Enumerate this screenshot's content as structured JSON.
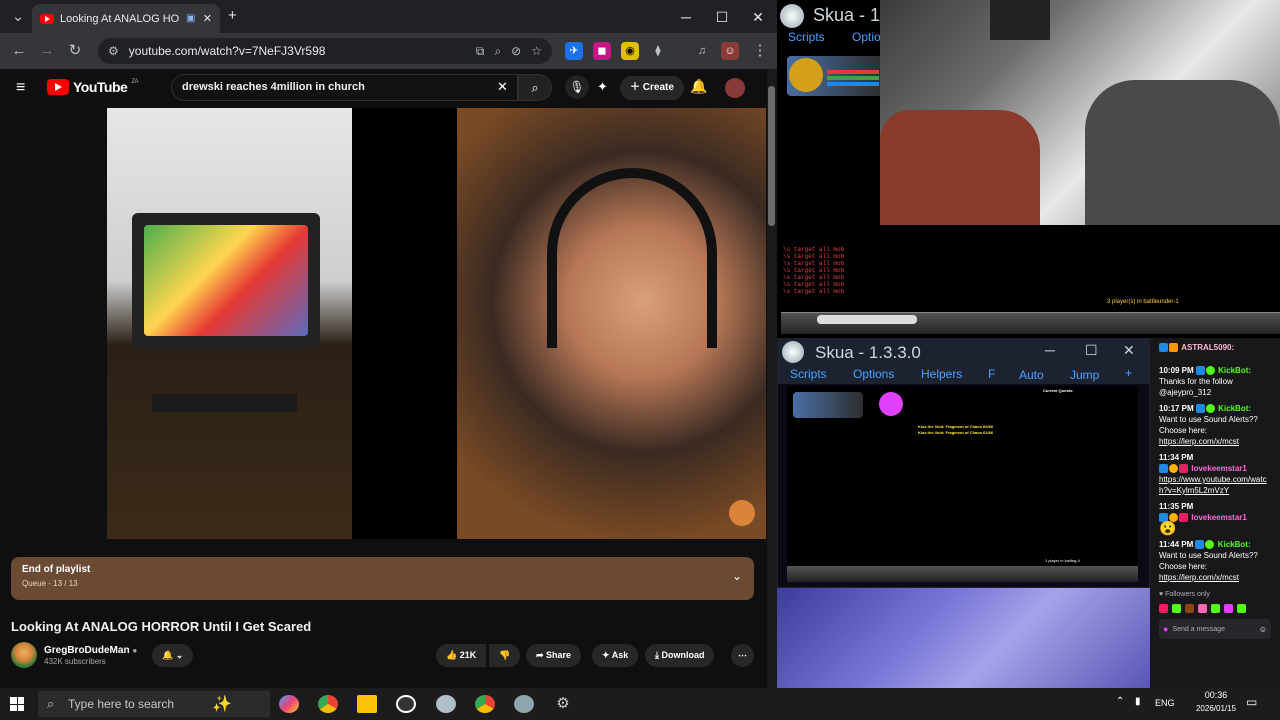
{
  "browser": {
    "tab_title": "Looking At ANALOG HORRO",
    "new_tab": "+",
    "url": "youtube.com/watch?v=7NeFJ3Vr598",
    "controls": {
      "minimize": "─",
      "maximize": "☐",
      "close": "✕"
    },
    "nav": {
      "back": "←",
      "forward": "→",
      "reload": "↻",
      "menu": "⋮"
    }
  },
  "youtube": {
    "logo_text": "YouTube",
    "region": "ZA",
    "search_query": "drewski reaches 4million in church",
    "create_label": "Create",
    "playlist": {
      "title": "End of playlist",
      "queue": "Queue - 13 / 13"
    },
    "video_title": "Looking At ANALOG HORROR Until I Get Scared",
    "channel": {
      "name": "GregBroDudeMan",
      "subscribers": "432K subscribers"
    },
    "actions": {
      "likes": "21K",
      "share": "Share",
      "ask": "Ask",
      "download": "Download"
    }
  },
  "skua_top": {
    "title": "Skua - 1",
    "menu": [
      "Scripts",
      "Optio"
    ],
    "log_lines": [
      "\\s target all mob",
      "\\s target all mob",
      "\\s target all mob",
      "\\s target all mob",
      "\\s target all mob",
      "\\s target all mob",
      "\\s target all mob"
    ],
    "status": "3 player(s) in battleunder-1"
  },
  "skua_bottom": {
    "title": "Skua - 1.3.3.0",
    "menu": [
      "Scripts",
      "Options",
      "Helpers",
      "F",
      "Auto",
      "Jump",
      "+"
    ],
    "quest_header": "Current Quests:",
    "kill_text_1": "Kiss the Void: Fragment of Chaos 60/66",
    "kill_text_2": "Kiss the Void: Fragment of Chaos 61/66",
    "player_count": "1 player in lostfeg-4"
  },
  "chat": {
    "top_user": "ASTRAL5090:",
    "messages": [
      {
        "time": "10:09 PM",
        "user": "KickBot:",
        "text": "Thanks for the follow @ajeypro_312",
        "link": ""
      },
      {
        "time": "10:17 PM",
        "user": "KickBot:",
        "text": "Want to use Sound Alerts?? Choose here:",
        "link": "https://lerp.com/x/mcst"
      },
      {
        "time": "11:34 PM",
        "user": "lovekeemstar1",
        "text": "",
        "link": "https://www.youtube.com/watch?v=Kylm5L2mVzY"
      },
      {
        "time": "11:35 PM",
        "user": "lovekeemstar1",
        "text": "",
        "link": ""
      },
      {
        "time": "11:44 PM",
        "user": "KickBot:",
        "text": "Want to use Sound Alerts?? Choose here:",
        "link": "https://lerp.com/x/mcst"
      }
    ],
    "followers_only": "Followers only",
    "send_placeholder": "Send a message"
  },
  "taskbar": {
    "search_placeholder": "Type here to search",
    "language": "ENG",
    "time": "00:36",
    "date": "2026/01/15"
  },
  "colors": {
    "youtube_red": "#ff0000",
    "kick_green": "#53fc18",
    "playlist_bg": "#6b4a34"
  }
}
